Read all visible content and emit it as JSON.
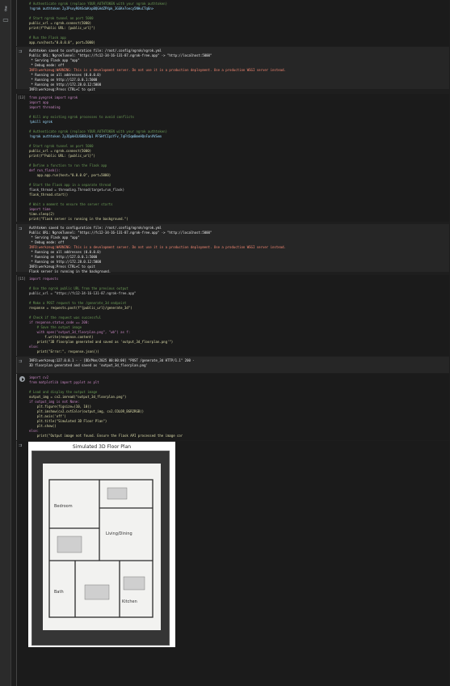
{
  "sidebar": {
    "icons": [
      "key-icon",
      "folder-icon"
    ]
  },
  "cells": {
    "c1": {
      "lines": [
        "# Authenticate ngrok (replace YOUR_AUTHTOKEN with your ngrok authtoken)",
        "!ngrok authtoken 2yJPsoyR0hSdaKnpBQGAdZPXpk_3GGKe7oecy5NHuCTq6n>",
        "",
        "# Start ngrok tunnel on port 5000",
        "public_url = ngrok.connect(5000)",
        "print(f\"Public URL: {public_url}\")",
        "",
        "# Run the Flask app",
        "app.run(host=\"0.0.0.0\", port=5000)"
      ]
    },
    "o1": {
      "lines": [
        "Authtoken saved to configuration file: /root/.config/ngrok/ngrok.yml",
        "Public URL: NgrokTunnel: \"https://fc12-34-16-131-87.ngrok-free.app\" -> \"http://localhost:5000\"",
        " * Serving Flask app \"app\"",
        " * Debug mode: off",
        "INFO:werkzeug:WARNING: This is a development server. Do not use it in a production deployment. Use a production WSGI server instead.",
        " * Running on all addresses (0.0.0.0)",
        " * Running on http://127.0.0.1:5000",
        " * Running on http://172.28.0.12:5000",
        "INFO:werkzeug:Press CTRL+C to quit"
      ]
    },
    "c2": {
      "label": "[13]",
      "lines": [
        "from pyngrok import ngrok",
        "import app",
        "import threading",
        "",
        "# Kill any existing ngrok processes to avoid conflicts",
        "!pkill ngrok",
        "",
        "# Authenticate ngrok (replace YOUR_AUTHTOKEN with your ngrok authtoken)",
        "!ngrok authtoken 2yJQpkH1UG8BLHp1 PFSHfCIpzYFv_7qFh5qmBmeHQnFanVVSem",
        "",
        "# Start ngrok tunnel on port 5000",
        "public_url = ngrok.connect(5000)",
        "print(f\"Public URL: {public_url}\")",
        "",
        "# Define a function to run the Flask app",
        "def run_flask():",
        "    app.app.run(host=\"0.0.0.0\", port=5000)",
        "",
        "# Start the Flask app in a separate thread",
        "flask_thread = threading.Thread(target=run_flask)",
        "flask_thread.start()",
        "",
        "# Wait a moment to ensure the server starts",
        "import time",
        "time.sleep(2)",
        "print(\"Flask server is running in the background.\")"
      ]
    },
    "o2": {
      "lines": [
        "Authtoken saved to configuration file: /root/.config/ngrok/ngrok.yml",
        "Public URL: NgrokTunnel: \"https://fc12-34-16-131-87.ngrok-free.app\" -> \"http://localhost:5000\"",
        " * Serving Flask app \"app\"",
        " * Debug mode: off",
        "INFO:werkzeug:WARNING: This is a development server. Do not use it in a production deployment. Use a production WSGI server instead.",
        " * Running on all addresses (0.0.0.0)",
        " * Running on http://127.0.0.1:5000",
        " * Running on http://172.28.0.12:5000",
        "INFO:werkzeug:Press CTRL+C to quit",
        "Flask server is running in the background."
      ]
    },
    "c3": {
      "label": "[15]",
      "lines": [
        "import requests",
        "",
        "# Use the ngrok public URL from the previous output",
        "public_url = \"https://fc12-34-16-131-87.ngrok-free.app\"",
        "",
        "# Make a POST request to the /generate_3d endpoint",
        "response = requests.post(f\"{public_url}/generate_3d\")",
        "",
        "# Check if the request was successful",
        "if response.status_code == 200:",
        "    # Save the output image",
        "    with open(\"output_3d_floorplan.png\", \"wb\") as f:",
        "        f.write(response.content)",
        "    print(\"3D floorplan generated and saved as 'output_3d_floorplan.png'\")",
        "else:",
        "    print(\"Error:\", response.json())"
      ]
    },
    "o3": {
      "lines": [
        "INFO:werkzeug:127.0.0.1 - - [DD/Mon/2025 00:00:00] \"POST /generate_3d HTTP/1.1\" 200 -",
        "3D floorplan generated and saved as 'output_3d_floorplan.png'"
      ]
    },
    "c4": {
      "lines": [
        "import cv2",
        "from matplotlib import pyplot as plt",
        "",
        "# Load and display the output image",
        "output_img = cv2.imread(\"output_3d_floorplan.png\")",
        "if output_img is not None:",
        "    plt.figure(figsize=(10, 10))",
        "    plt.imshow(cv2.cvtColor(output_img, cv2.COLOR_BGR2RGB))",
        "    plt.axis('off')",
        "    plt.title(\"Simulated 3D Floor Plan\")",
        "    plt.show()",
        "else:",
        "    print(\"Output image not found. Ensure the Flask API processed the image correctly.\")"
      ]
    },
    "o4": {
      "figure_title": "Simulated 3D Floor Plan",
      "rooms": [
        "Living/Dining",
        "Bedroom",
        "Kitchen",
        "Bath"
      ]
    }
  }
}
